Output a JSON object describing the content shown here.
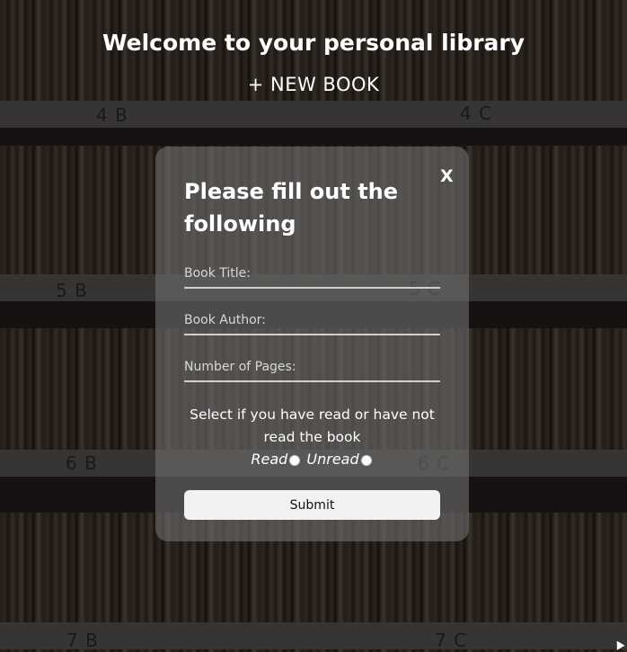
{
  "header": {
    "title": "Welcome to your personal library",
    "new_book_label": "+ NEW BOOK"
  },
  "shelf_labels": [
    "4 B",
    "4 C",
    "5 B",
    "5 C",
    "6 B",
    "6 C",
    "7 B",
    "7 C"
  ],
  "modal": {
    "close_label": "X",
    "title": "Please fill out the following",
    "fields": {
      "title_placeholder": "Book Title:",
      "author_placeholder": "Book Author:",
      "pages_placeholder": "Number of Pages:"
    },
    "read_prompt": "Select if you have read or have not read the book",
    "read_option": "Read",
    "unread_option": "Unread",
    "submit_label": "Submit"
  }
}
